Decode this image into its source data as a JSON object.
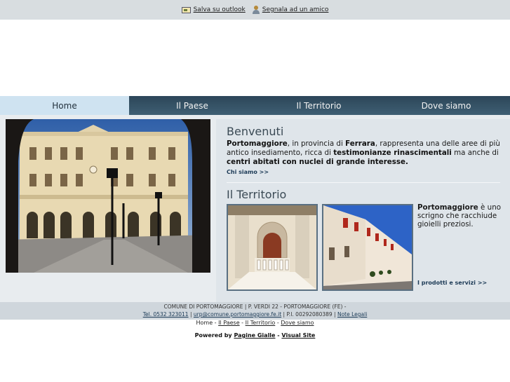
{
  "topbar": {
    "outlook_label": "Salva su outlook",
    "friend_label": "Segnala ad un amico"
  },
  "nav": {
    "tabs": [
      "Home",
      "Il Paese",
      "Il Territorio",
      "Dove siamo"
    ],
    "active": "Home"
  },
  "welcome": {
    "title": "Benvenuti",
    "town": "Portomaggiore",
    "text_1": ", in provincia di ",
    "province": "Ferrara",
    "text_2": ", rappresenta una delle aree di più antico insediamento, ricca di ",
    "bold_1": "testimonianze rinascimentali",
    "text_3": " ma anche di ",
    "bold_2": "centri abitati con nuclei di grande interesse.",
    "more": "Chi siamo >>"
  },
  "territorio": {
    "title": "Il Territorio",
    "town": "Portomaggiore",
    "text": " è uno scrigno che racchiude gioielli preziosi.",
    "more": "I prodotti e servizi >>"
  },
  "footer": {
    "address": "COMUNE DI PORTOMAGGIORE | P. VERDI 22 - PORTOMAGGIORE (FE) -",
    "tel": "Tel. 0532 323011",
    "email": "urp@comune.portomaggiore.fe.it",
    "piva": "| P.I. 00292080389 |",
    "legal": "Note Legali",
    "sep1": "|",
    "links": [
      "Home",
      "Il Paese",
      "Il Territorio",
      "Dove siamo"
    ],
    "powered_prefix": "Powered by",
    "powered_a": "Pagine Gialle",
    "powered_sep": "-",
    "powered_b": "Visual Site"
  },
  "colors": {
    "nav_bg": "#2c4659",
    "nav_active": "#cfe3f1",
    "panel_bg": "#dfe5ea",
    "link_blue": "#1c3a56"
  }
}
